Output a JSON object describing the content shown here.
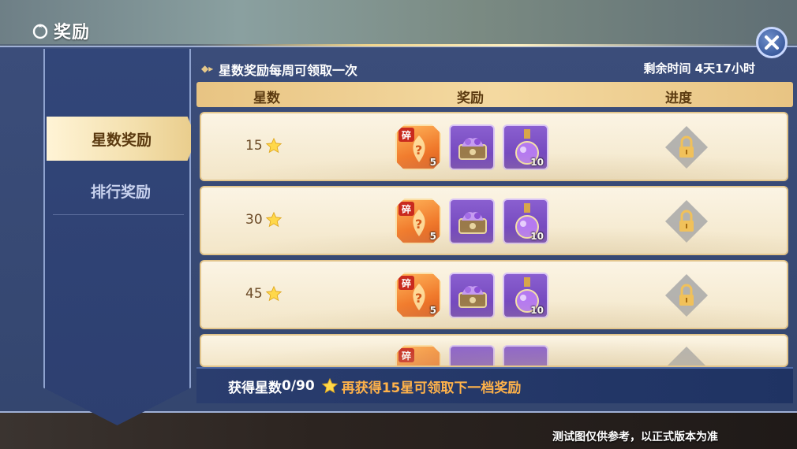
{
  "window": {
    "title": "奖励"
  },
  "sidebar": {
    "tabs": [
      {
        "label": "星数奖励",
        "active": true
      },
      {
        "label": "排行奖励",
        "active": false
      }
    ]
  },
  "notice": {
    "text": "星数奖励每周可领取一次",
    "remaining": "剩余时间 4天17小时"
  },
  "table": {
    "headers": [
      "星数",
      "奖励",
      "进度"
    ],
    "rows": [
      {
        "stars": "15",
        "items": [
          {
            "tag": "碎",
            "count": "5",
            "icon": "hero-fragment-icon"
          },
          {
            "icon": "gem-chest-icon"
          },
          {
            "count": "10",
            "icon": "potion-icon"
          }
        ],
        "status": "locked"
      },
      {
        "stars": "30",
        "items": [
          {
            "tag": "碎",
            "count": "5",
            "icon": "hero-fragment-icon"
          },
          {
            "icon": "gem-chest-icon"
          },
          {
            "count": "10",
            "icon": "potion-icon"
          }
        ],
        "status": "locked"
      },
      {
        "stars": "45",
        "items": [
          {
            "tag": "碎",
            "count": "5",
            "icon": "hero-fragment-icon"
          },
          {
            "icon": "gem-chest-icon"
          },
          {
            "count": "10",
            "icon": "potion-icon"
          }
        ],
        "status": "locked"
      },
      {
        "stars": "",
        "items": [
          {
            "tag": "碎",
            "icon": "hero-fragment-icon"
          },
          {
            "icon": "gem-chest-icon"
          },
          {
            "icon": "potion-icon"
          }
        ],
        "status": "locked"
      }
    ]
  },
  "footer": {
    "label": "获得星数",
    "count": "0/90",
    "hint": "再获得15星可领取下一档奖励"
  },
  "disclaimer": "测试图仅供参考，以正式版本为准",
  "colors": {
    "panel": "#34466f",
    "header_gold": "#f4d9a0",
    "accent_orange": "#ffb24a",
    "item_purple": "#6b3fb5"
  }
}
